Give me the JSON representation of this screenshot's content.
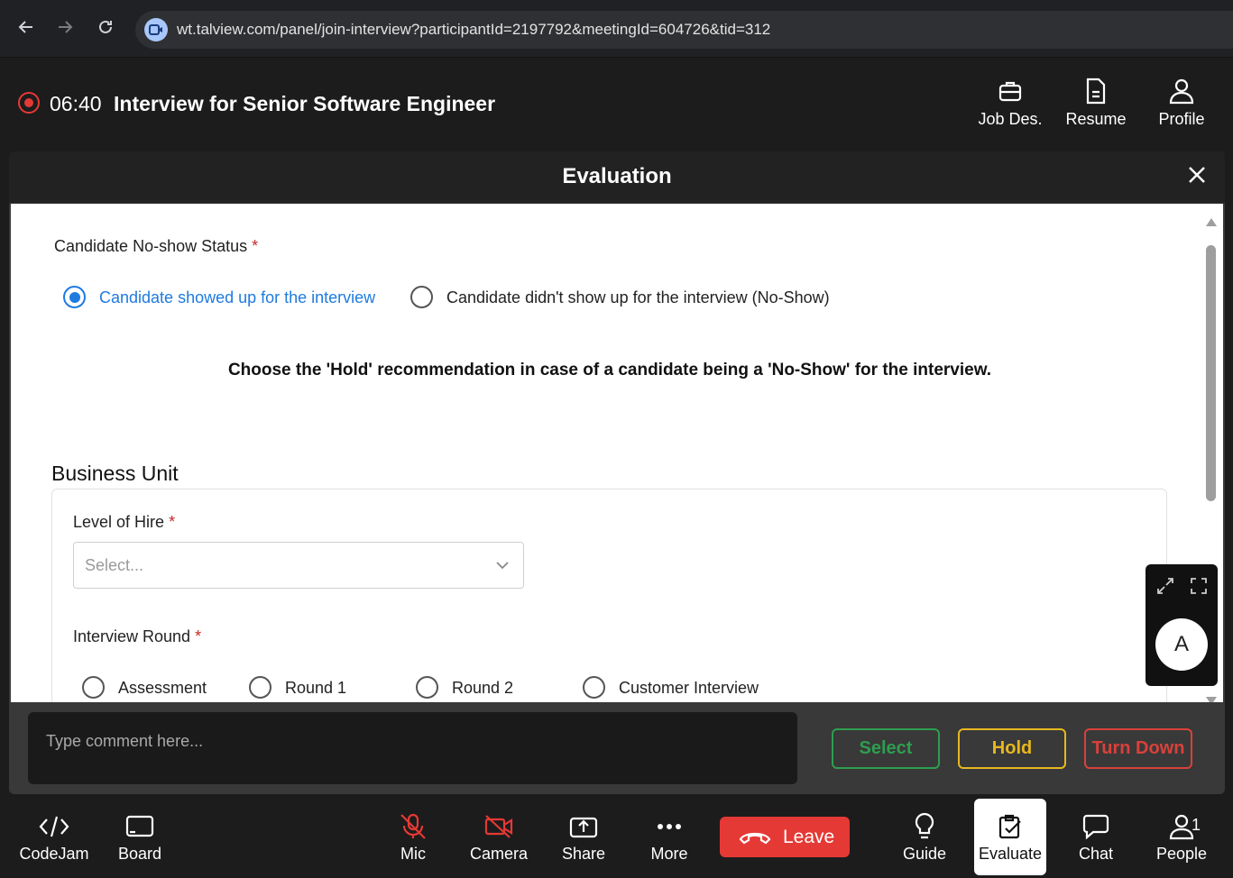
{
  "browser": {
    "url": "wt.talview.com/panel/join-interview?participantId=2197792&meetingId=604726&tid=312",
    "back_icon": "arrow-left-icon",
    "forward_icon": "arrow-right-icon",
    "reload_icon": "reload-icon"
  },
  "header": {
    "timer": "06:40",
    "title": "Interview for Senior Software Engineer",
    "actions": [
      {
        "label": "Job Des.",
        "icon": "briefcase-icon"
      },
      {
        "label": "Resume",
        "icon": "document-icon"
      },
      {
        "label": "Profile",
        "icon": "person-icon"
      }
    ]
  },
  "evaluation": {
    "title": "Evaluation",
    "noshow_label": "Candidate No-show Status",
    "required_mark": "*",
    "noshow_options": [
      {
        "label": "Candidate showed up for the interview",
        "selected": true
      },
      {
        "label": "Candidate didn't show up for the interview (No-Show)",
        "selected": false
      }
    ],
    "notice": "Choose the 'Hold' recommendation in case of a candidate being a 'No-Show' for the interview.",
    "section_title": "Business Unit",
    "level_label": "Level of Hire",
    "level_placeholder": "Select...",
    "round_label": "Interview Round",
    "round_options": [
      "Assessment",
      "Round 1",
      "Round 2",
      "Customer Interview"
    ]
  },
  "comment": {
    "placeholder": "Type comment here..."
  },
  "decisions": {
    "select_label": "Select",
    "hold_label": "Hold",
    "turndown_label": "Turn Down",
    "select_color": "#2e9e4f",
    "hold_color": "#e6b820",
    "turndown_color": "#d9413b"
  },
  "floating": {
    "avatar_letter": "A"
  },
  "toolbar": {
    "codejam": "CodeJam",
    "board": "Board",
    "mic": "Mic",
    "camera": "Camera",
    "share": "Share",
    "more": "More",
    "leave": "Leave",
    "guide": "Guide",
    "evaluate": "Evaluate",
    "chat": "Chat",
    "people": "People",
    "people_count": "1"
  }
}
